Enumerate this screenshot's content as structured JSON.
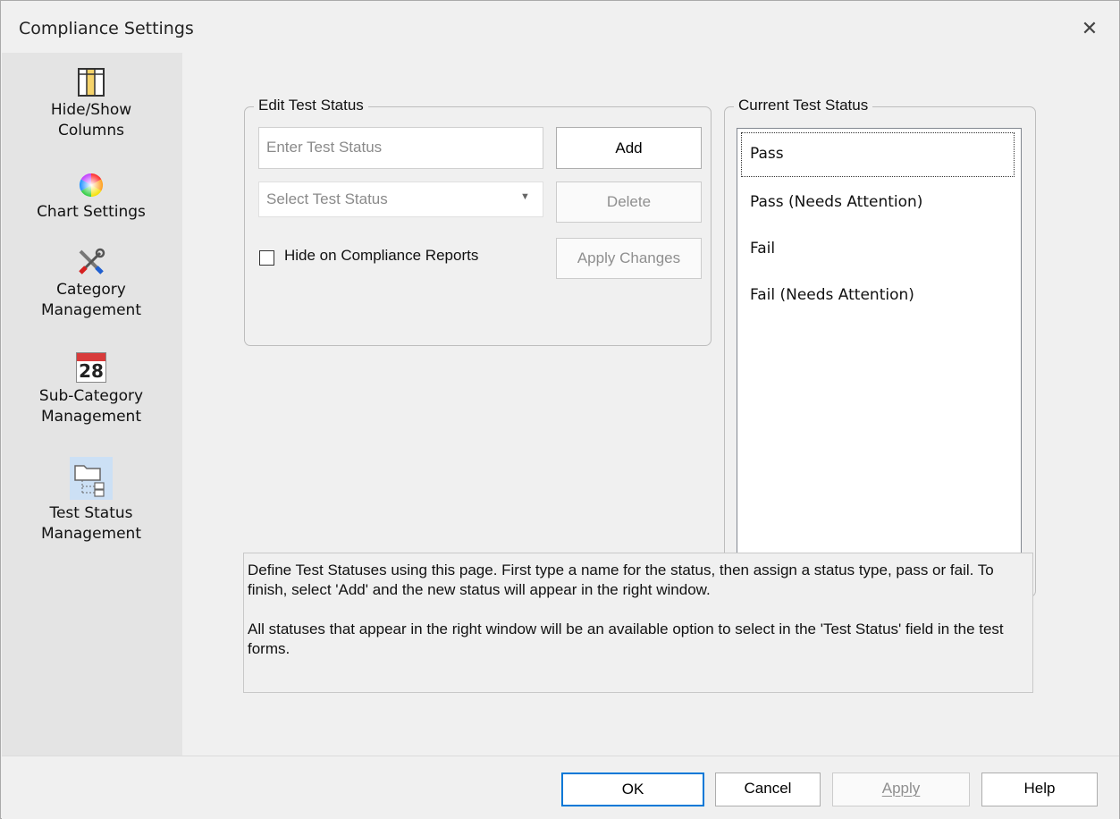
{
  "window": {
    "title": "Compliance Settings",
    "close_glyph": "✕"
  },
  "sidebar": {
    "items": [
      {
        "label1": "Hide/Show",
        "label2": "Columns",
        "icon": "columns-icon"
      },
      {
        "label1": "Chart Settings",
        "label2": "",
        "icon": "color-wheel-icon"
      },
      {
        "label1": "Category",
        "label2": "Management",
        "icon": "tools-icon"
      },
      {
        "label1": "Sub-Category",
        "label2": "Management",
        "icon": "calendar-icon",
        "icon_text": "28"
      },
      {
        "label1": "Test Status",
        "label2": "Management",
        "icon": "folder-tree-icon",
        "selected": true
      }
    ]
  },
  "edit_group": {
    "legend": "Edit Test Status",
    "status_input_placeholder": "Enter Test Status",
    "status_select_placeholder": "Select Test Status",
    "add_label": "Add",
    "delete_label": "Delete",
    "checkbox_label": "Hide on Compliance Reports",
    "apply_changes_label": "Apply Changes"
  },
  "current_group": {
    "legend": "Current Test Status",
    "items": [
      "Pass",
      "Pass (Needs Attention)",
      "Fail",
      "Fail (Needs Attention)"
    ]
  },
  "info": {
    "para1": "Define Test Statuses using this page.  First type a name for the status, then assign a status type, pass or fail.  To finish, select 'Add' and the new status will appear in the right window.",
    "para2": "All statuses that appear in the right window will be an available option to select in the 'Test Status' field in the test forms."
  },
  "footer": {
    "ok_label": "OK",
    "cancel_label": "Cancel",
    "apply_label": "Apply",
    "help_label": "Help"
  },
  "colors": {
    "accent": "#0078d7",
    "sidebar_bg": "#e4e4e4",
    "dialog_bg": "#f0f0f0"
  }
}
